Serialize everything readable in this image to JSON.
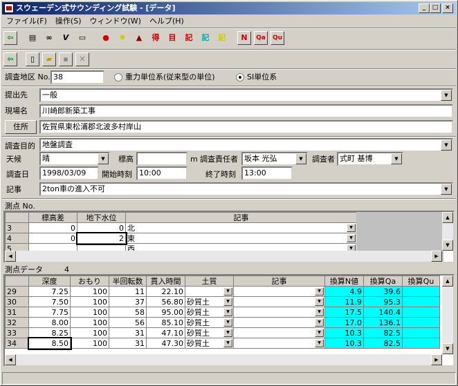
{
  "window": {
    "title": "スウェーデン式サウンディング試験 - [データ]",
    "min": "_",
    "max": "□",
    "close": "×"
  },
  "menu": [
    "ファイル(F)",
    "操作(S)",
    "ウィンドウ(W)",
    "ヘルプ(H)"
  ],
  "toolbar_text": {
    "n": "N",
    "qa": "Qa",
    "qu": "Qu"
  },
  "form": {
    "area_label": "調査地区 No.",
    "area_no": "38",
    "unit_gravity": "重力単位系(従来型の単位)",
    "unit_si": "SI単位系",
    "submit_label": "提出先",
    "submit_value": "一般",
    "site_label": "現場名",
    "site_value": "川崎郎新築工事",
    "address_button": "住所",
    "address_value": "佐賀県東松浦郡北波多村岸山",
    "purpose_label": "調査目的",
    "purpose_value": "地盤調査",
    "weather_label": "天候",
    "weather_value": "晴",
    "elev_label": "標高",
    "elev_value": "",
    "elev_unit": "m",
    "chief_label": "調査責任者",
    "chief_value": "坂本 光弘",
    "surveyor_label": "調査者",
    "surveyor_value": "式町 基博",
    "date_label": "調査日",
    "date_value": "1998/03/09",
    "start_label": "開始時刻",
    "start_value": "10:00",
    "end_label": "終了時刻",
    "end_value": "13:00",
    "note_label": "記事",
    "note_value": "2ton車の進入不可"
  },
  "points": {
    "section_label": "測点 No.",
    "headers": [
      "",
      "標高差",
      "地下水位",
      "記事"
    ],
    "rows": [
      {
        "no": "3",
        "elev": "0",
        "water": "0",
        "note": "北"
      },
      {
        "no": "4",
        "elev": "0",
        "water": "2",
        "note": "東"
      },
      {
        "no": "5",
        "elev": "",
        "water": "",
        "note": "西"
      }
    ]
  },
  "data": {
    "section_label": "測点データ",
    "count": "4",
    "headers": [
      "",
      "深度",
      "おもり",
      "半回転数",
      "貫入時間",
      "土質",
      "記事",
      "換算N値",
      "換算Qa",
      "換算Qu"
    ],
    "rows": [
      {
        "no": "29",
        "depth": "7.25",
        "weight": "100",
        "turns": "11",
        "time": "22.10",
        "soil": "",
        "note": "",
        "n": "4.9",
        "qa": "39.6",
        "qu": ""
      },
      {
        "no": "30",
        "depth": "7.50",
        "weight": "100",
        "turns": "37",
        "time": "56.80",
        "soil": "砂質土",
        "note": "",
        "n": "11.9",
        "qa": "95.3",
        "qu": ""
      },
      {
        "no": "31",
        "depth": "7.75",
        "weight": "100",
        "turns": "58",
        "time": "95.00",
        "soil": "砂質土",
        "note": "",
        "n": "17.5",
        "qa": "140.4",
        "qu": ""
      },
      {
        "no": "32",
        "depth": "8.00",
        "weight": "100",
        "turns": "56",
        "time": "85.10",
        "soil": "砂質土",
        "note": "",
        "n": "17.0",
        "qa": "136.1",
        "qu": ""
      },
      {
        "no": "33",
        "depth": "8.25",
        "weight": "100",
        "turns": "31",
        "time": "47.10",
        "soil": "砂質土",
        "note": "",
        "n": "10.3",
        "qa": "82.5",
        "qu": ""
      },
      {
        "no": "34",
        "depth": "8.50",
        "weight": "100",
        "turns": "31",
        "time": "47.30",
        "soil": "砂質土",
        "note": "",
        "n": "10.3",
        "qa": "82.5",
        "qu": ""
      }
    ]
  }
}
